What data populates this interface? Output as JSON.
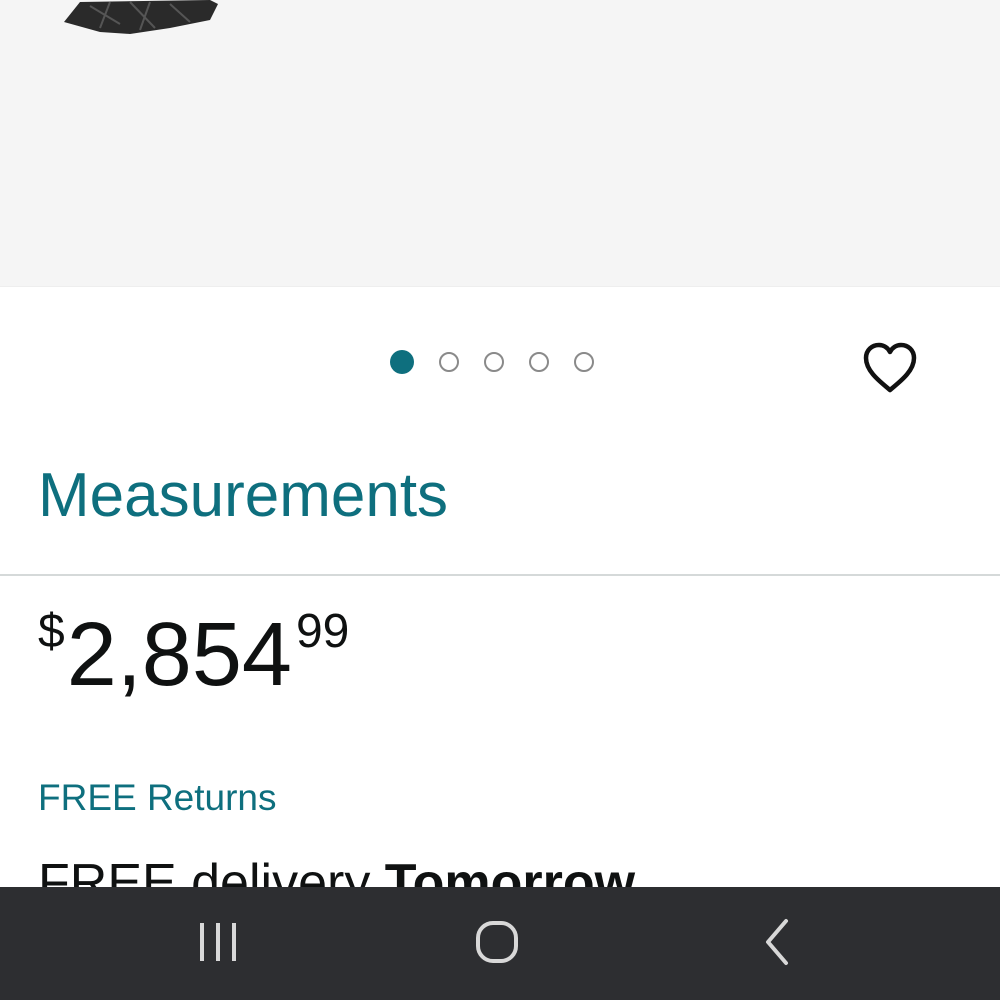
{
  "colors": {
    "accent": "#007185",
    "dot_active": "#0e6f7e",
    "text_dark": "#0f1111",
    "navbar": "#2d2e31"
  },
  "product": {
    "image": {
      "dot_count": 5,
      "active_index": 0
    },
    "wishlist_icon": "heart-outline-icon"
  },
  "measurements_link": "Measurements",
  "price": {
    "symbol": "$",
    "whole": "2,854",
    "fraction": "99"
  },
  "free_returns": "FREE Returns",
  "delivery": {
    "prefix": "FREE delivery ",
    "date": "Tomorrow"
  },
  "navbar": {
    "recent_icon": "recent-apps-icon",
    "home_icon": "home-icon",
    "back_icon": "back-icon"
  }
}
